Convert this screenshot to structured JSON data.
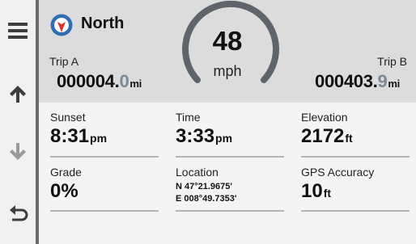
{
  "toolbar": {
    "icons": [
      "menu-icon",
      "arrow-up-icon",
      "arrow-down-icon",
      "back-icon"
    ]
  },
  "heading": {
    "icon": "compass-icon",
    "label": "North"
  },
  "trip_a": {
    "label": "Trip A",
    "value_main": "000004.",
    "value_decimal": "0",
    "unit": "mi"
  },
  "trip_b": {
    "label": "Trip B",
    "value_main": "000403.",
    "value_decimal": "9",
    "unit": "mi"
  },
  "speed": {
    "value": "48",
    "unit": "mph"
  },
  "fields": {
    "sunset": {
      "label": "Sunset",
      "value": "8:31",
      "unit": "pm"
    },
    "time": {
      "label": "Time",
      "value": "3:33",
      "unit": "pm"
    },
    "elevation": {
      "label": "Elevation",
      "value": "2172",
      "unit": "ft"
    },
    "grade": {
      "label": "Grade",
      "value": "0%"
    },
    "location": {
      "label": "Location",
      "lat": "N 47°21.9675'",
      "lon": "E 008°49.7353'"
    },
    "gps_accuracy": {
      "label": "GPS Accuracy",
      "value": "10",
      "unit": "ft"
    }
  },
  "colors": {
    "top_panel": "#dcdcdc",
    "grid_panel": "#f4f4f4",
    "toolbar": "#f0f0f0",
    "toolbar_separator": "#6b6b6b",
    "decimal_dim": "#7c8a96",
    "gauge_arc": "#5e646a",
    "compass_blue": "#2f6db5",
    "compass_red": "#d8322a",
    "icon_gray": "#3e3e3e",
    "icon_disabled": "#9a9a9a"
  }
}
